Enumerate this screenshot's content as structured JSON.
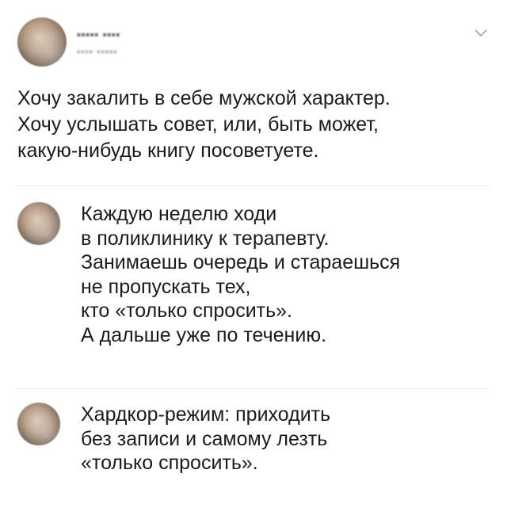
{
  "post": {
    "author": {
      "name": "▪▪▪▪▪ ▪▪▪▪",
      "handle": "▪▪▪▪ ▪▪▪▪▪"
    },
    "text_lines": [
      "Хочу закалить в себе мужской характер.",
      "Хочу услышать совет, или, быть может,",
      "какую-нибудь книгу посоветуете."
    ]
  },
  "replies": [
    {
      "text_lines": [
        "Каждую неделю ходи",
        "в поликлинику к терапевту.",
        "Занимаешь очередь и стараешься",
        "не пропускать тех,",
        "кто «только спросить».",
        "А дальше уже по течению."
      ]
    },
    {
      "text_lines": [
        "Хардкор-режим: приходить",
        "без записи и самому лезть",
        "«только спросить»."
      ]
    }
  ],
  "icons": {
    "menu": "chevron-down-icon"
  },
  "colors": {
    "divider": "#e6ecf0",
    "text": "#1b1b1b",
    "chevron": "#9aa6b0"
  }
}
